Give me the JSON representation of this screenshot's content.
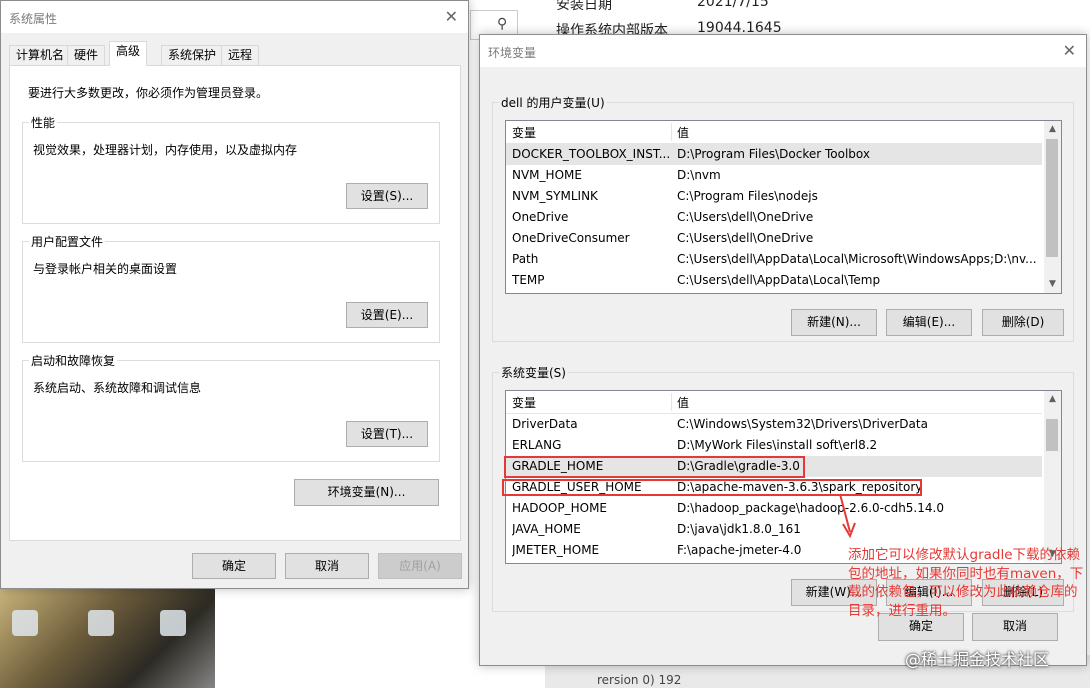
{
  "background": {
    "install_date_label": "安装日期",
    "install_date_value": "2021/7/15",
    "os_build_label": "操作系统内部版本",
    "os_build_value": "19044.1645",
    "search_icon": "search-icon",
    "bottom_text": "rersion 0) 192"
  },
  "sysprops": {
    "title": "系统属性",
    "tabs": [
      "计算机名",
      "硬件",
      "高级",
      "系统保护",
      "远程"
    ],
    "active_tab": "高级",
    "admin_note": "要进行大多数更改，你必须作为管理员登录。",
    "performance": {
      "label": "性能",
      "desc": "视觉效果，处理器计划，内存使用，以及虚拟内存",
      "button": "设置(S)..."
    },
    "profiles": {
      "label": "用户配置文件",
      "desc": "与登录帐户相关的桌面设置",
      "button": "设置(E)..."
    },
    "startup": {
      "label": "启动和故障恢复",
      "desc": "系统启动、系统故障和调试信息",
      "button": "设置(T)..."
    },
    "env_button": "环境变量(N)...",
    "ok": "确定",
    "cancel": "取消",
    "apply": "应用(A)"
  },
  "envvars": {
    "title": "环境变量",
    "user_group_label": "dell 的用户变量(U)",
    "col_var": "变量",
    "col_val": "值",
    "user_vars": [
      {
        "name": "DOCKER_TOOLBOX_INST...",
        "value": "D:\\Program Files\\Docker Toolbox"
      },
      {
        "name": "NVM_HOME",
        "value": "D:\\nvm"
      },
      {
        "name": "NVM_SYMLINK",
        "value": "C:\\Program Files\\nodejs"
      },
      {
        "name": "OneDrive",
        "value": "C:\\Users\\dell\\OneDrive"
      },
      {
        "name": "OneDriveConsumer",
        "value": "C:\\Users\\dell\\OneDrive"
      },
      {
        "name": "Path",
        "value": "C:\\Users\\dell\\AppData\\Local\\Microsoft\\WindowsApps;D:\\nv..."
      },
      {
        "name": "TEMP",
        "value": "C:\\Users\\dell\\AppData\\Local\\Temp"
      }
    ],
    "user_buttons": {
      "new": "新建(N)...",
      "edit": "编辑(E)...",
      "delete": "删除(D)"
    },
    "system_group_label": "系统变量(S)",
    "system_vars": [
      {
        "name": "DriverData",
        "value": "C:\\Windows\\System32\\Drivers\\DriverData"
      },
      {
        "name": "ERLANG",
        "value": "D:\\MyWork Files\\install soft\\erl8.2"
      },
      {
        "name": "GRADLE_HOME",
        "value": "D:\\Gradle\\gradle-3.0"
      },
      {
        "name": "GRADLE_USER_HOME",
        "value": "D:\\apache-maven-3.6.3\\spark_repository"
      },
      {
        "name": "HADOOP_HOME",
        "value": "D:\\hadoop_package\\hadoop-2.6.0-cdh5.14.0"
      },
      {
        "name": "JAVA_HOME",
        "value": "D:\\java\\jdk1.8.0_161"
      },
      {
        "name": "JMETER_HOME",
        "value": "F:\\apache-jmeter-4.0"
      }
    ],
    "system_buttons": {
      "new": "新建(W)...",
      "edit": "编辑(I)...",
      "delete": "删除(L)"
    },
    "ok": "确定",
    "cancel": "取消"
  },
  "annotation": {
    "text": "添加它可以修改默认gradle下载的依赖包的地址，如果你同时也有maven，下载的依赖包，可以修改为此依赖仓库的目录，进行重用。",
    "color": "#e53935"
  },
  "watermark": "@稀土掘金技术社区"
}
